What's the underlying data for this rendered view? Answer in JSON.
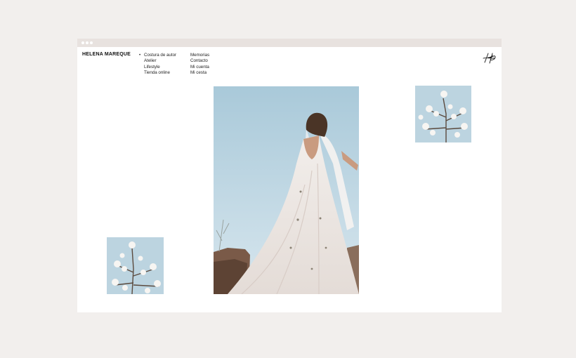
{
  "site": {
    "brand": "HELENA MAREQUE",
    "logo_icon": "hm-monogram-icon",
    "nav_primary": [
      "Costura de autor",
      "Atelier",
      "Lifestyle",
      "Tienda online"
    ],
    "nav_secondary": [
      "Memorias",
      "Contacto",
      "Mi cuenta",
      "Mi cesta"
    ]
  },
  "colors": {
    "page_background": "#f2efed",
    "browser_bar": "#e8e2df",
    "sky": "#bcd4e0"
  },
  "images": {
    "main": "bride-white-gown-photo",
    "accent_right": "magnolia-branch-photo",
    "accent_left": "magnolia-branch-photo"
  }
}
